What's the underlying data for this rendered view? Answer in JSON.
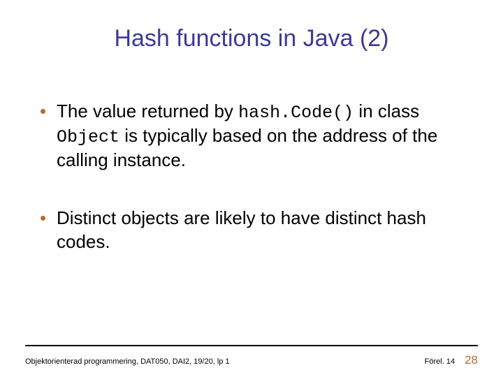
{
  "title": "Hash functions in Java (2)",
  "bullets": {
    "b1": {
      "pre": "The value returned by ",
      "code1": "hash.Code()",
      "mid": " in class ",
      "code2": "Object",
      "post": " is typically based on the address of the calling instance."
    },
    "b2": {
      "text": "Distinct objects are likely to have distinct hash codes."
    }
  },
  "footer": {
    "left": "Objektorienterad programmering, DAT050, DAI2, 19/20, lp 1",
    "lecture": "Förel. 14",
    "page": "28"
  }
}
